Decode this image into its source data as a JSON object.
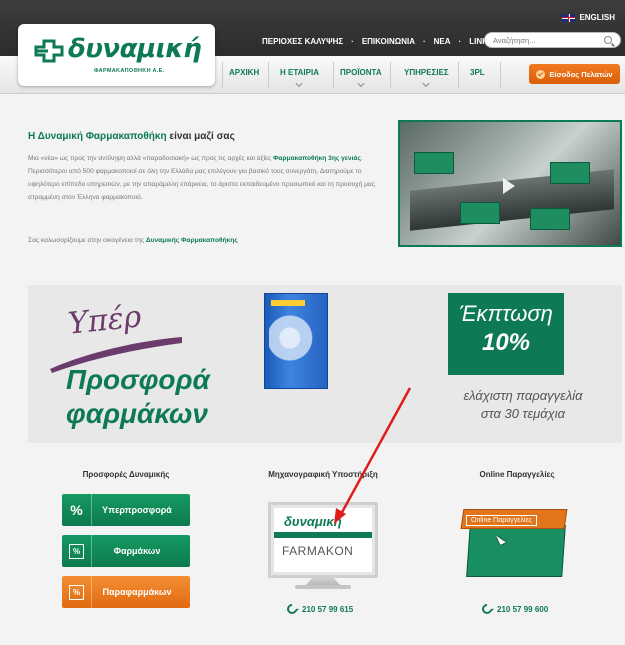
{
  "header": {
    "language": "ENGLISH",
    "top_nav": [
      "ΠΕΡΙΟΧΕΣ ΚΑΛΥΨΗΣ",
      "ΕΠΙΚΟΙΝΩΝΙΑ",
      "ΝΕΑ",
      "LINKS"
    ],
    "search_placeholder": "Αναζήτηση...",
    "logo_text": "δυναμική",
    "logo_sub": "ΦΑΡΜΑΚΑΠΟΘΗΚΗ Α.Ε.",
    "main_nav": [
      "ΑΡΧΙΚΗ",
      "Η ΕΤΑΙΡΙΑ",
      "ΠΡΟΪΟΝΤΑ",
      "ΥΠΗΡΕΣΙΕΣ",
      "3PL"
    ],
    "login_label": "Είσοδος Πελατών",
    "accent": "#0e7a55",
    "orange": "#e06a10"
  },
  "intro": {
    "title_brand": "Η Δυναμική Φαρμακαποθήκη",
    "title_rest": " είναι μαζί σας",
    "p1_a": "Μια «νέα» ως προς την αντίληψη αλλά «παραδοσιακή» ως προς τις αρχές και αξίες",
    "p1_b_bold": "Φαρμακαποθήκη 3ης γενιάς",
    "p1_c": ". Περισσότεροι από 500 φαρμακοποιοί σε όλη την Ελλάδα μας επιλέγουν για βασικό τους συνεργάτη. Διατηρούμε το υψηλότερο επίπεδο υπηρεσιών, με την απαράμιλλη επάρκεια, το άριστα εκπαιδευμένο προσωπικό και τη προσοχή μας στραμμένη στον Έλληνα φαρμακοποιό.",
    "p2_a": "Σας καλωσορίζουμε στην οικογένεια της ",
    "p2_b_bold": "Δυναμικής Φαρμακαποθήκης"
  },
  "promo": {
    "yper": "Υπέρ",
    "line1": "Προσφορά",
    "line2": "φαρμάκων",
    "discount_word": "Έκπτωση",
    "discount_pct": "10%",
    "note_line1": "ελάχιστη παραγγελία",
    "note_line2": "στα 30 τεμάχια"
  },
  "columns": {
    "offers_title": "Προσφορές Δυναμικής",
    "offers_buttons": [
      "Υπερπροσφορά",
      "Φαρμάκων",
      "Παραφαρμάκων"
    ],
    "support_title": "Μηχανογραφική Υποστήριξη",
    "support_monitor_logo": "δυναμική",
    "support_monitor_product": "FARMAKON",
    "support_phone": "210 57 99 615",
    "orders_title": "Online Παραγγελίες",
    "orders_crate_label": "Online Παραγγελίες",
    "orders_phone": "210 57 99 600"
  }
}
